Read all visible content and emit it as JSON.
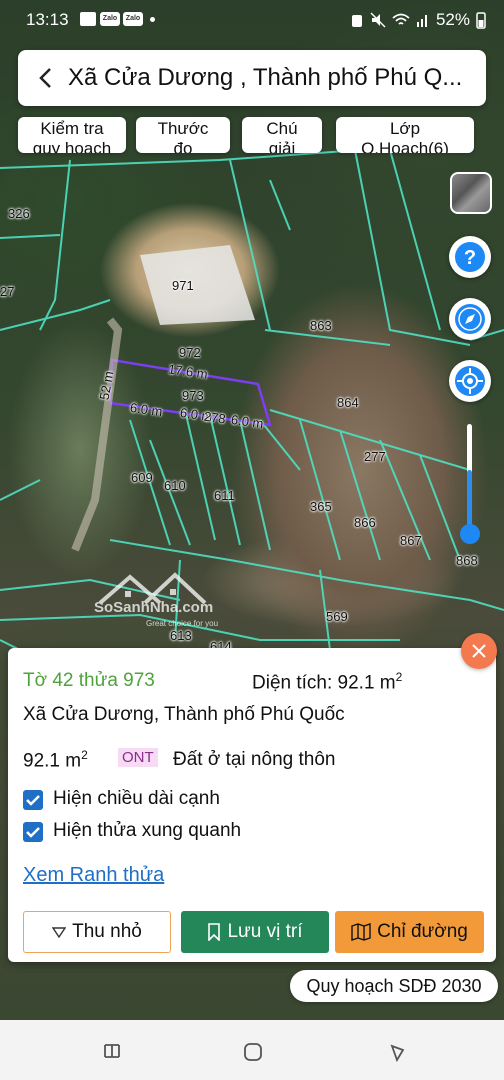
{
  "status_bar": {
    "time": "13:13",
    "notif_icons": [
      "gallery-icon",
      "zalo-icon",
      "zalo-icon",
      "dot-icon"
    ],
    "notif_labels": [
      "Zalo",
      "Zalo"
    ],
    "battery": "52%"
  },
  "search": {
    "title": "Xã Cửa Dương , Thành phố Phú Q..."
  },
  "chips": [
    {
      "line1": "Kiểm tra",
      "line2": "quy hoạch"
    },
    {
      "line1": "Thước",
      "line2": "đo"
    },
    {
      "line1": "Chú",
      "line2": "giải"
    },
    {
      "line1": "Lớp",
      "line2": "Q.Hoạch(6)"
    }
  ],
  "map": {
    "parcel_numbers": [
      "326",
      "27",
      "971",
      "863",
      "972",
      "973",
      "864",
      "277",
      "609",
      "610",
      "611",
      "365",
      "866",
      "867",
      "868",
      "569",
      "613",
      "614"
    ],
    "edge_lengths": [
      "17.6 m",
      "52 m",
      "6.0 m",
      "6.0 m",
      "278",
      "6.0 m"
    ],
    "watermark": {
      "brand": "SoSanhNha.com",
      "tagline": "Great choice for you"
    }
  },
  "info_card": {
    "title": "Tờ 42 thửa 973",
    "area_label": "Diện tích: 92.1 m",
    "area_sup": "2",
    "address": "Xã Cửa Dương, Thành phố Phú Quốc",
    "size": "92.1 m",
    "size_sup": "2",
    "land_code": "ONT",
    "land_type": "Đất ở tại nông thôn",
    "show_edge_lengths": "Hiện chiều dài cạnh",
    "show_neighbors": "Hiện thửa xung quanh",
    "view_boundary": "Xem Ranh thửa",
    "collapse_btn": "Thu nhỏ",
    "save_btn": "Lưu vị trí",
    "directions_btn": "Chỉ đường"
  },
  "plan_label": "Quy hoạch SDĐ 2030",
  "colors": {
    "accent_green": "#23875a",
    "accent_orange": "#f2993a",
    "title_green": "#4fa33a",
    "link_blue": "#1f6fc6",
    "parcel_line": "#4ee0c2",
    "selected_parcel": "#7b3ff2"
  }
}
